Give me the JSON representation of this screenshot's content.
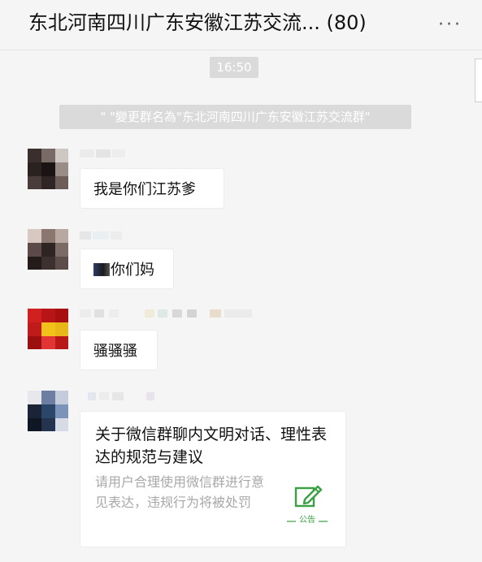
{
  "header": {
    "title": "东北河南四川广东安徽江苏交流... (80)",
    "more_icon": "more-dots-icon",
    "more_label": "···"
  },
  "chat": {
    "timestamp": "16:50",
    "system_message": "\"    \"變更群名為\"东北河南四川广东安徽江苏交流群\"",
    "messages": [
      {
        "text": "我是你们江苏爹"
      },
      {
        "text": "你们妈",
        "has_pixelated_emoji": true
      },
      {
        "text": "骚骚骚"
      }
    ],
    "notice_card": {
      "title": "关于微信群聊内文明对话、理性表达的规范与建议",
      "description": "请用户合理使用微信群进行意见表达，违规行为将被处罚",
      "icon": "edit-note-icon",
      "icon_label": "公告",
      "accent_color": "#3aa043"
    }
  },
  "colors": {
    "background": "#f5f5f5",
    "bubble": "#ffffff",
    "system_pill": "#dadada",
    "notice_accent": "#3aa043"
  }
}
